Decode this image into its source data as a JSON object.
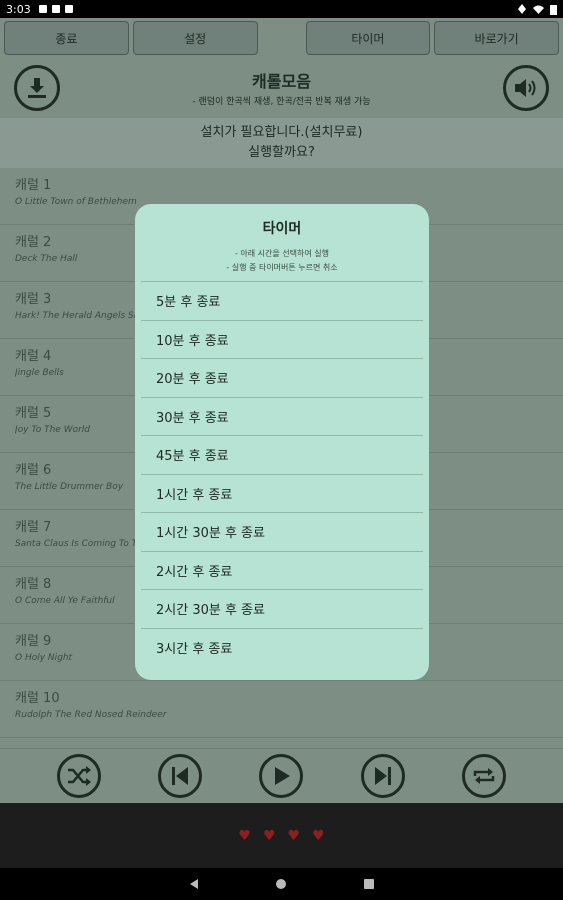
{
  "status_bar": {
    "time": "3:03"
  },
  "top_buttons": {
    "exit": "종료",
    "settings": "설정",
    "timer": "타이머",
    "shortcut": "바로가기"
  },
  "header": {
    "title": "캐롤모음",
    "subtitle": "- 랜덤이 한곡씩 재생, 한곡/전곡 반복 재생 가능"
  },
  "install_banner": {
    "line1": "설치가 필요합니다.(설치무료)",
    "line2": "실행할까요?"
  },
  "songs": [
    {
      "title": "캐럴 1",
      "subtitle": "O Little Town of Bethlehem"
    },
    {
      "title": "캐럴 2",
      "subtitle": "Deck The Hall"
    },
    {
      "title": "캐럴 3",
      "subtitle": "Hark! The Herald Angels Sing"
    },
    {
      "title": "캐럴 4",
      "subtitle": "Jingle Bells"
    },
    {
      "title": "캐럴 5",
      "subtitle": "Joy To The World"
    },
    {
      "title": "캐럴 6",
      "subtitle": "The Little Drummer Boy"
    },
    {
      "title": "캐럴 7",
      "subtitle": "Santa Claus Is Coming To Town"
    },
    {
      "title": "캐럴 8",
      "subtitle": "O Come All Ye Faithful"
    },
    {
      "title": "캐럴 9",
      "subtitle": "O Holy Night"
    },
    {
      "title": "캐럴 10",
      "subtitle": "Rudolph The Red Nosed Reindeer"
    }
  ],
  "timer_modal": {
    "title": "타이머",
    "hint1": "- 아래 시간을 선택하여 실행",
    "hint2": "- 실행 중 타이머버튼 누르면 취소",
    "options": [
      "5분 후 종료",
      "10분 후 종료",
      "20분 후 종료",
      "30분 후 종료",
      "45분 후 종료",
      "1시간 후 종료",
      "1시간 30분 후 종료",
      "2시간 후 종료",
      "2시간 30분 후 종료",
      "3시간 후 종료"
    ]
  },
  "colors": {
    "modal_bg": "#b6e3d3",
    "app_bg": "#7d8e85",
    "ad_bg": "#1d1d1d",
    "heart": "#8e1f1f"
  }
}
